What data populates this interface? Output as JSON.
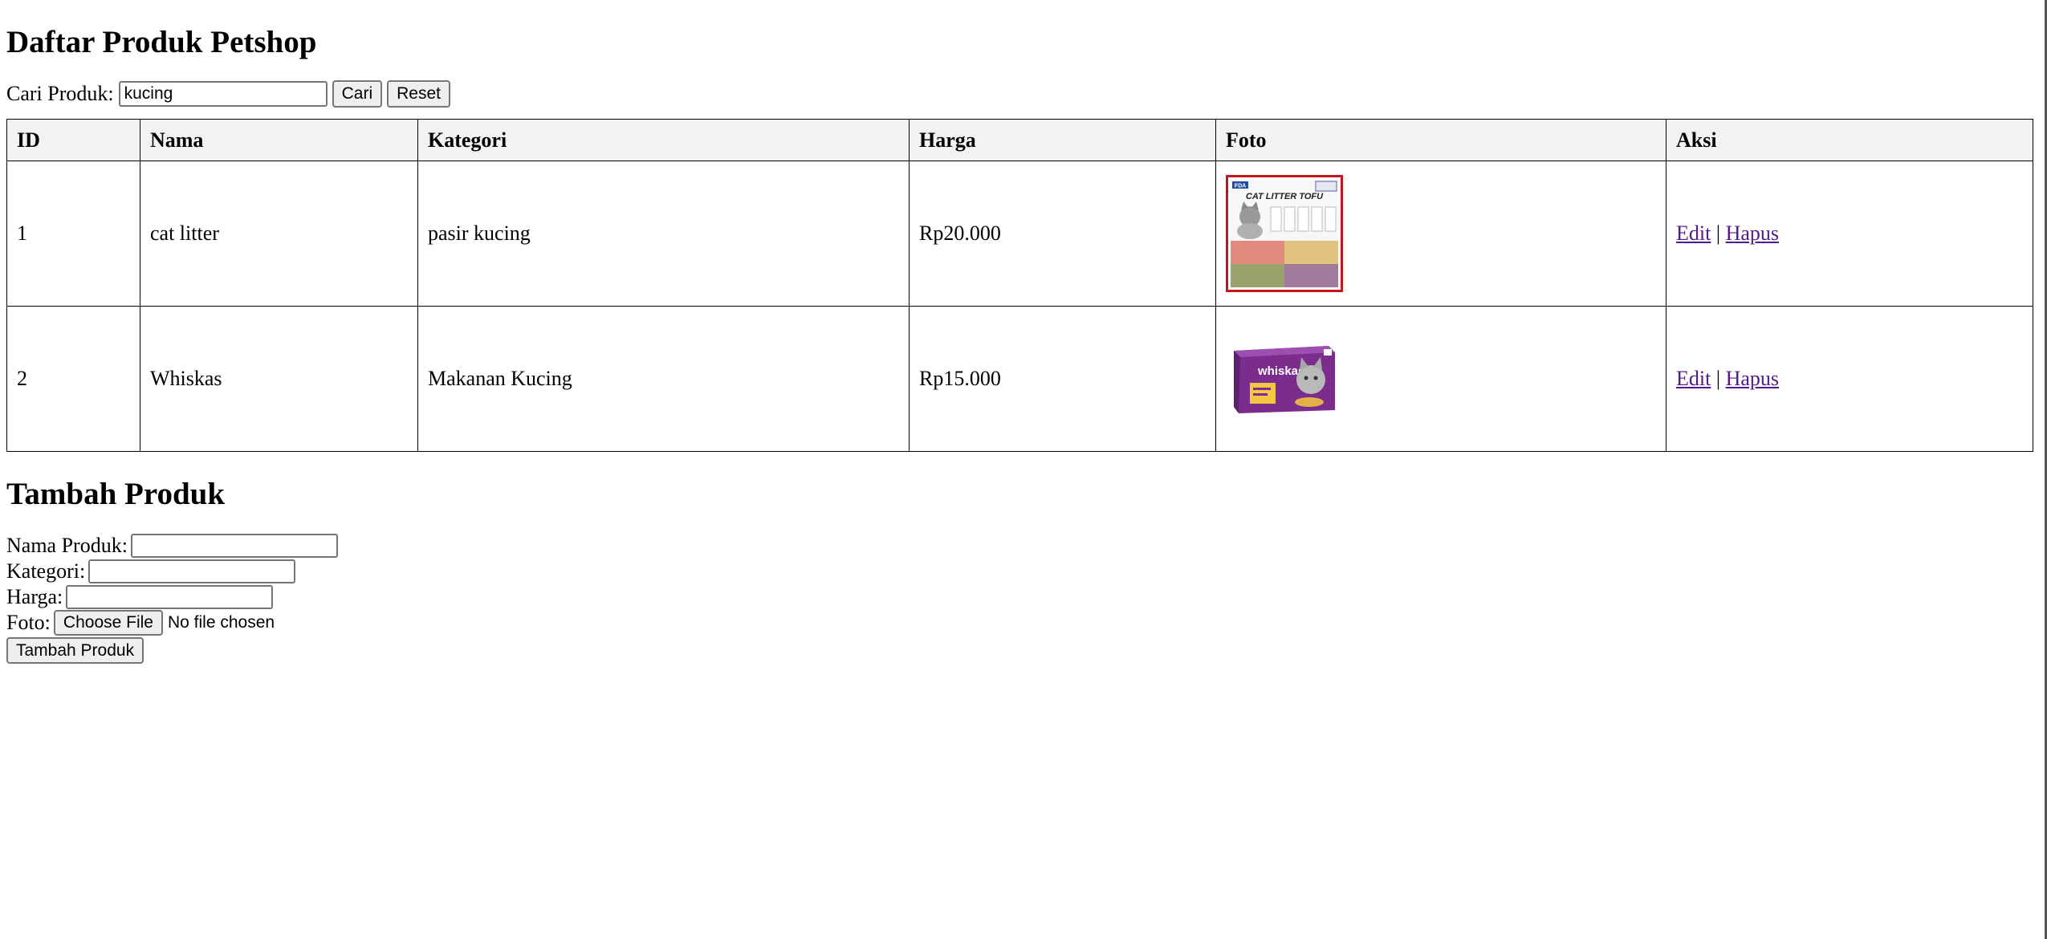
{
  "page": {
    "title": "Daftar Produk Petshop"
  },
  "search": {
    "label": "Cari Produk:",
    "value": "kucing",
    "search_button": "Cari",
    "reset_button": "Reset"
  },
  "table": {
    "headers": [
      "ID",
      "Nama",
      "Kategori",
      "Harga",
      "Foto",
      "Aksi"
    ],
    "rows": [
      {
        "id": "1",
        "nama": "cat litter",
        "kategori": "pasir kucing",
        "harga": "Rp20.000",
        "foto_text": "CAT LITTER TOFU",
        "foto_brand": "FDA",
        "edit": "Edit",
        "separator": "|",
        "hapus": "Hapus"
      },
      {
        "id": "2",
        "nama": "Whiskas",
        "kategori": "Makanan Kucing",
        "harga": "Rp15.000",
        "foto_text": "whiskas",
        "edit": "Edit",
        "separator": "|",
        "hapus": "Hapus"
      }
    ]
  },
  "add_form": {
    "title": "Tambah Produk",
    "nama_label": "Nama Produk:",
    "nama_value": "",
    "kategori_label": "Kategori:",
    "kategori_value": "",
    "harga_label": "Harga:",
    "harga_value": "",
    "foto_label": "Foto:",
    "file_button": "Choose File",
    "file_status": "No file chosen",
    "submit_button": "Tambah Produk"
  },
  "colors": {
    "header_bg": "#f2f2f2",
    "visited_link": "#551a8b",
    "whiskas_purple": "#7b2d8e",
    "litter_border": "#c4161c"
  }
}
